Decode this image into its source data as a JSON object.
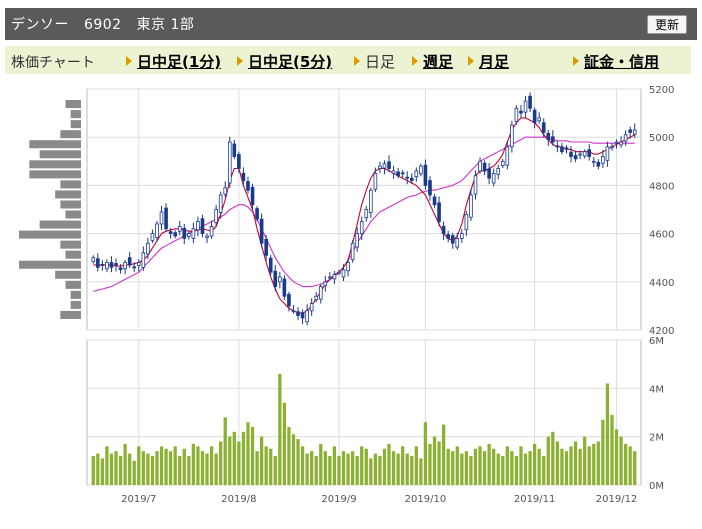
{
  "header": {
    "company": "デンソー",
    "code": "6902",
    "market": "東京 1部",
    "refresh_label": "更新"
  },
  "nav": {
    "label": "株価チャート",
    "items": [
      {
        "label": "日中足(1分)",
        "current": false
      },
      {
        "label": "日中足(5分)",
        "current": false
      },
      {
        "label": "日足",
        "current": true
      },
      {
        "label": "週足",
        "current": false
      },
      {
        "label": "月足",
        "current": false
      },
      {
        "label": "証金・信用",
        "current": false
      }
    ]
  },
  "chart_data": [
    {
      "type": "candlestick",
      "title": "",
      "x_tick_labels": [
        "2019/7",
        "2019/8",
        "2019/9",
        "2019/10",
        "2019/11",
        "2019/12"
      ],
      "y_tick_labels": [
        "5200",
        "5000",
        "4800",
        "4600",
        "4400",
        "4200"
      ],
      "ylim": [
        4200,
        5200
      ],
      "grid": true,
      "colors": {
        "up": "#ffffff",
        "down": "#1a3a8c",
        "ma_short": "#cc0033",
        "ma_long": "#cc33cc",
        "volume_profile": "#8a8a8a"
      },
      "close": [
        4500,
        4460,
        4470,
        4480,
        4460,
        4470,
        4450,
        4480,
        4470,
        4460,
        4480,
        4520,
        4560,
        4600,
        4640,
        4690,
        4620,
        4600,
        4590,
        4630,
        4580,
        4600,
        4620,
        4650,
        4600,
        4590,
        4630,
        4700,
        4760,
        4790,
        4980,
        4920,
        4870,
        4820,
        4780,
        4720,
        4660,
        4560,
        4510,
        4440,
        4380,
        4420,
        4340,
        4300,
        4280,
        4260,
        4250,
        4280,
        4310,
        4340,
        4380,
        4400,
        4420,
        4430,
        4440,
        4450,
        4480,
        4560,
        4600,
        4650,
        4700,
        4780,
        4850,
        4880,
        4890,
        4870,
        4860,
        4840,
        4850,
        4830,
        4820,
        4860,
        4880,
        4800,
        4760,
        4720,
        4650,
        4600,
        4580,
        4560,
        4580,
        4600,
        4680,
        4760,
        4840,
        4900,
        4860,
        4830,
        4850,
        4870,
        4900,
        4960,
        5050,
        5120,
        5100,
        5150,
        5120,
        5060,
        5080,
        5020,
        4990,
        4980,
        4960,
        4940,
        4950,
        4920,
        4910,
        4930,
        4940,
        4920,
        4900,
        4880,
        4920,
        4960,
        4960,
        4980,
        4980,
        5010,
        5020,
        5030
      ],
      "ma_short": [
        4470,
        4470,
        4470,
        4470,
        4470,
        4465,
        4465,
        4470,
        4470,
        4475,
        4480,
        4490,
        4510,
        4540,
        4570,
        4600,
        4610,
        4615,
        4620,
        4620,
        4615,
        4610,
        4610,
        4615,
        4620,
        4615,
        4610,
        4630,
        4680,
        4740,
        4820,
        4870,
        4870,
        4800,
        4750,
        4700,
        4620,
        4550,
        4480,
        4420,
        4370,
        4330,
        4310,
        4290,
        4280,
        4270,
        4270,
        4280,
        4300,
        4330,
        4360,
        4390,
        4410,
        4430,
        4440,
        4460,
        4490,
        4560,
        4640,
        4720,
        4780,
        4830,
        4860,
        4870,
        4870,
        4860,
        4850,
        4840,
        4830,
        4820,
        4810,
        4800,
        4780,
        4760,
        4720,
        4680,
        4640,
        4600,
        4580,
        4570,
        4590,
        4640,
        4720,
        4780,
        4840,
        4860,
        4860,
        4870,
        4880,
        4900,
        4930,
        4980,
        5030,
        5060,
        5080,
        5080,
        5070,
        5060,
        5040,
        5010,
        4990,
        4970,
        4960,
        4960,
        4950,
        4950,
        4940,
        4940,
        4940,
        4940,
        4930,
        4930,
        4940,
        4950,
        4960,
        4970,
        4980,
        4990,
        5000,
        5010
      ],
      "ma_long": [
        4360,
        4365,
        4370,
        4375,
        4380,
        4390,
        4400,
        4410,
        4420,
        4430,
        4440,
        4460,
        4480,
        4500,
        4520,
        4540,
        4550,
        4560,
        4570,
        4580,
        4590,
        4600,
        4610,
        4620,
        4630,
        4640,
        4650,
        4660,
        4670,
        4680,
        4700,
        4710,
        4720,
        4720,
        4710,
        4690,
        4660,
        4620,
        4580,
        4540,
        4500,
        4470,
        4440,
        4420,
        4400,
        4390,
        4380,
        4380,
        4380,
        4385,
        4390,
        4400,
        4410,
        4420,
        4440,
        4460,
        4490,
        4520,
        4560,
        4590,
        4620,
        4650,
        4670,
        4690,
        4700,
        4710,
        4720,
        4730,
        4740,
        4750,
        4755,
        4760,
        4770,
        4775,
        4780,
        4780,
        4785,
        4790,
        4795,
        4800,
        4810,
        4820,
        4840,
        4860,
        4880,
        4900,
        4910,
        4920,
        4930,
        4940,
        4950,
        4960,
        4970,
        4980,
        4990,
        5000,
        5000,
        5000,
        5000,
        5000,
        4995,
        4990,
        4985,
        4985,
        4985,
        4980,
        4980,
        4980,
        4980,
        4980,
        4975,
        4975,
        4975,
        4975,
        4975,
        4975,
        4975,
        4975,
        4975,
        4975
      ]
    },
    {
      "type": "bar",
      "title": "",
      "x_tick_labels": [
        "2019/7",
        "2019/8",
        "2019/9",
        "2019/10",
        "2019/11",
        "2019/12"
      ],
      "y_tick_labels": [
        "6M",
        "4M",
        "2M",
        "0M"
      ],
      "ylim": [
        0,
        6
      ],
      "grid": true,
      "colors": {
        "bar": "#8ab132"
      },
      "values": [
        1.2,
        1.3,
        1.1,
        1.6,
        1.3,
        1.4,
        1.2,
        1.7,
        1.3,
        1.0,
        1.6,
        1.4,
        1.3,
        1.2,
        1.4,
        1.6,
        1.5,
        1.4,
        1.6,
        1.2,
        1.5,
        1.2,
        1.7,
        1.6,
        1.4,
        1.3,
        1.6,
        1.3,
        1.8,
        2.8,
        2.0,
        2.2,
        1.8,
        2.2,
        2.6,
        2.4,
        1.4,
        2.0,
        1.6,
        1.5,
        1.2,
        4.6,
        3.4,
        2.4,
        2.1,
        1.9,
        1.6,
        1.3,
        1.4,
        1.2,
        1.7,
        1.4,
        1.2,
        1.6,
        1.2,
        1.4,
        1.3,
        1.4,
        1.2,
        1.6,
        1.5,
        1.1,
        1.3,
        1.2,
        1.5,
        1.7,
        1.4,
        1.3,
        1.6,
        1.3,
        1.2,
        1.6,
        1.1,
        2.6,
        1.7,
        2.0,
        1.8,
        2.5,
        1.5,
        1.4,
        1.6,
        1.3,
        1.4,
        1.2,
        1.5,
        1.6,
        1.4,
        1.7,
        1.5,
        1.3,
        1.2,
        1.6,
        1.4,
        1.2,
        1.6,
        1.3,
        1.4,
        1.7,
        1.5,
        1.2,
        2.0,
        2.2,
        1.8,
        1.5,
        1.4,
        1.6,
        1.8,
        1.5,
        2.0,
        1.6,
        1.7,
        1.8,
        2.7,
        4.2,
        2.9,
        2.3,
        2.0,
        1.7,
        1.6,
        1.4
      ]
    }
  ]
}
